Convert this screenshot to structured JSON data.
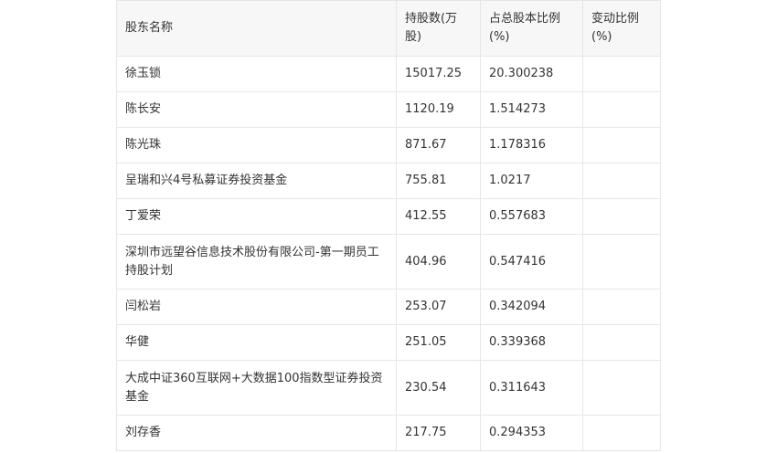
{
  "table": {
    "headers": [
      "股东名称",
      "持股数(万股)",
      "占总股本比例(%)",
      "变动比例(%)"
    ],
    "rows": [
      [
        "徐玉锁",
        "15017.25",
        "20.300238",
        ""
      ],
      [
        "陈长安",
        "1120.19",
        "1.514273",
        ""
      ],
      [
        "陈光珠",
        "871.67",
        "1.178316",
        ""
      ],
      [
        "呈瑞和兴4号私募证券投资基金",
        "755.81",
        "1.0217",
        ""
      ],
      [
        "丁爱荣",
        "412.55",
        "0.557683",
        ""
      ],
      [
        "深圳市远望谷信息技术股份有限公司-第一期员工持股计划",
        "404.96",
        "0.547416",
        ""
      ],
      [
        "闫松岩",
        "253.07",
        "0.342094",
        ""
      ],
      [
        "华健",
        "251.05",
        "0.339368",
        ""
      ],
      [
        "大成中证360互联网+大数据100指数型证券投资基金",
        "230.54",
        "0.311643",
        ""
      ],
      [
        "刘存香",
        "217.75",
        "0.294353",
        ""
      ]
    ]
  }
}
